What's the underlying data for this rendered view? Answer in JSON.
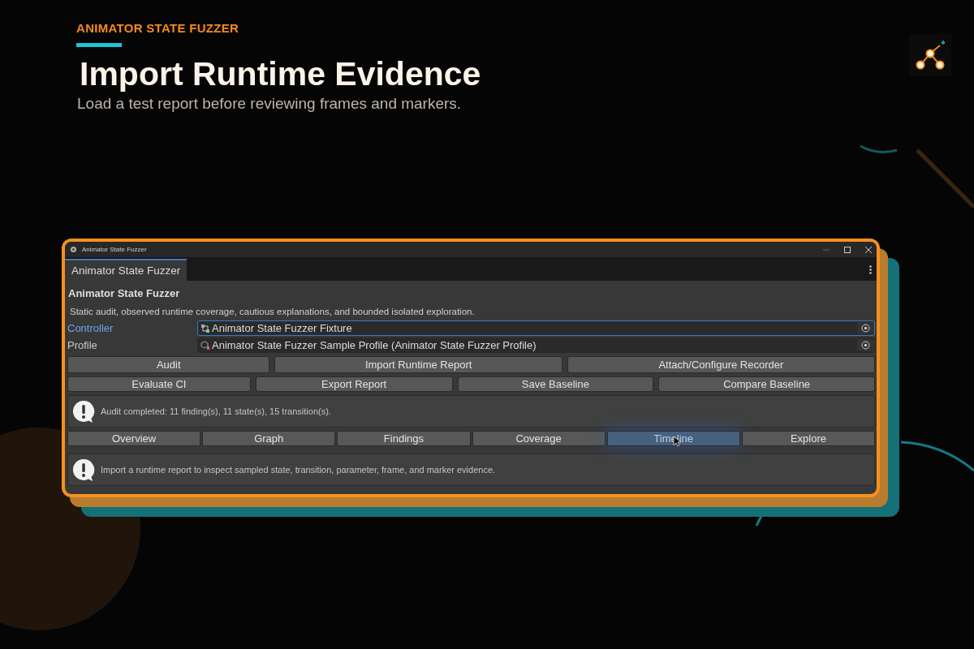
{
  "header": {
    "eyebrow": "ANIMATOR STATE FUZZER",
    "title": "Import Runtime Evidence",
    "subtitle": "Load a test report before reviewing frames and markers."
  },
  "window": {
    "title": "Animator State Fuzzer",
    "tab": "Animator State Fuzzer",
    "heading": "Animator State Fuzzer",
    "description": "Static audit, observed runtime coverage, cautious explanations, and bounded isolated exploration.",
    "fields": [
      {
        "label": "Controller",
        "value": "Animator State Fuzzer Fixture",
        "kind": "controller",
        "focused": true
      },
      {
        "label": "Profile",
        "value": "Animator State Fuzzer Sample Profile (Animator State Fuzzer Profile)",
        "kind": "profile",
        "focused": false
      }
    ],
    "action_rows": [
      [
        "Audit",
        "Import Runtime Report",
        "Attach/Configure Recorder"
      ],
      [
        "Evaluate CI",
        "Export Report",
        "Save Baseline",
        "Compare Baseline"
      ]
    ],
    "status_message": "Audit completed: 11 finding(s), 11 state(s), 15 transition(s).",
    "view_tabs": [
      {
        "label": "Overview",
        "selected": false
      },
      {
        "label": "Graph",
        "selected": false
      },
      {
        "label": "Findings",
        "selected": false
      },
      {
        "label": "Coverage",
        "selected": false
      },
      {
        "label": "Timeline",
        "selected": true
      },
      {
        "label": "Explore",
        "selected": false
      }
    ],
    "help_message": "Import a runtime report to inspect sampled state, transition, parameter, frame, and marker evidence."
  }
}
